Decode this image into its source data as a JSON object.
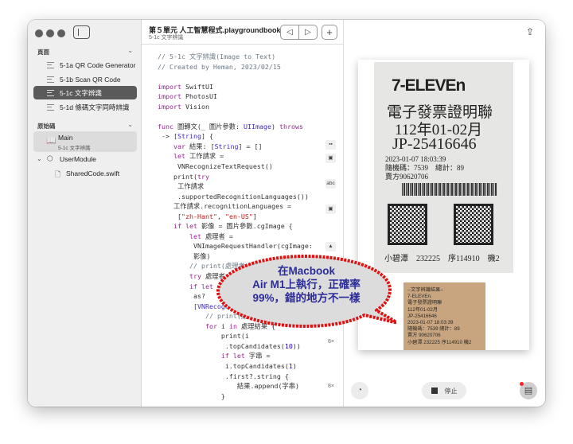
{
  "window": {
    "title": "第５單元 人工智慧程式.playgroundbook",
    "subtitle": "5-1c 文字辨識"
  },
  "sidebar": {
    "pages_header": "頁面",
    "pages": [
      {
        "label": "5-1a QR Code Generator"
      },
      {
        "label": "5-1b Scan QR Code"
      },
      {
        "label": "5-1c 文字辨識",
        "selected": true
      },
      {
        "label": "5-1d 條碼文字同時辨識"
      }
    ],
    "source_header": "原始碼",
    "main": {
      "label": "Main",
      "sub": "5-1c 文字辨識"
    },
    "module": "UserModule",
    "file": "SharedCode.swift"
  },
  "code_lines": [
    [
      [
        "// 5-1c 文字辨識(Image to Text)",
        "cm"
      ]
    ],
    [
      [
        "// Created by Heman, 2023/02/15",
        "cm"
      ]
    ],
    [],
    [
      [
        "import",
        "kw"
      ],
      [
        " SwiftUI",
        ""
      ]
    ],
    [
      [
        "import",
        "kw"
      ],
      [
        " PhotosUI",
        ""
      ]
    ],
    [
      [
        "import",
        "kw"
      ],
      [
        " Vision",
        ""
      ]
    ],
    [],
    [
      [
        "func",
        "kw"
      ],
      [
        " 圖轉文(_ 圖片參數: ",
        ""
      ],
      [
        "UIImage",
        "ty"
      ],
      [
        ") ",
        ""
      ],
      [
        "throws",
        "kw"
      ]
    ],
    [
      [
        " -> [",
        ""
      ],
      [
        "String",
        "ty"
      ],
      [
        "] {",
        ""
      ]
    ],
    [
      [
        "    ",
        ""
      ],
      [
        "var",
        "kw"
      ],
      [
        " 結果: [",
        ""
      ],
      [
        "String",
        "ty"
      ],
      [
        "] = []",
        ""
      ]
    ],
    [
      [
        "    ",
        ""
      ],
      [
        "let",
        "kw"
      ],
      [
        " 工作請求 =",
        ""
      ]
    ],
    [
      [
        "     VNRecognizeTextRequest()",
        ""
      ]
    ],
    [
      [
        "    print(",
        ""
      ],
      [
        "try",
        "kw"
      ]
    ],
    [
      [
        "     工作請求",
        ""
      ]
    ],
    [
      [
        "     .supportedRecognitionLanguages())",
        ""
      ]
    ],
    [
      [
        "    工作請求.recognitionLanguages =",
        ""
      ]
    ],
    [
      [
        "     [",
        ""
      ],
      [
        "\"zh-Hant\"",
        "st"
      ],
      [
        ", ",
        ""
      ],
      [
        "\"en-US\"",
        "st"
      ],
      [
        "]",
        ""
      ]
    ],
    [
      [
        "    ",
        ""
      ],
      [
        "if let",
        "kw"
      ],
      [
        " 影像 = 圖片參數.cgImage {",
        ""
      ]
    ],
    [
      [
        "        ",
        ""
      ],
      [
        "let",
        "kw"
      ],
      [
        " 處理者 =",
        ""
      ]
    ],
    [
      [
        "         VNImageRequestHandler(cgImage:",
        ""
      ]
    ],
    [
      [
        "         影像)",
        ""
      ]
    ],
    [
      [
        "        ",
        ""
      ],
      [
        "// print(處理者)",
        "cm"
      ]
    ],
    [
      [
        "        ",
        ""
      ],
      [
        "try",
        "kw"
      ],
      [
        " 處理者",
        ""
      ]
    ],
    [
      [
        "        ",
        ""
      ],
      [
        "if let",
        "kw"
      ]
    ],
    [
      [
        "         as?",
        ""
      ]
    ],
    [
      [
        "         [",
        ""
      ],
      [
        "VNRecognizedTextObservation",
        "ty"
      ]
    ],
    [
      [
        "            ",
        ""
      ],
      [
        "// print(處理結果)",
        "cm"
      ]
    ],
    [
      [
        "            ",
        ""
      ],
      [
        "for",
        "kw"
      ],
      [
        " i ",
        ""
      ],
      [
        "in",
        "kw"
      ],
      [
        " 處理結果 {",
        ""
      ]
    ],
    [
      [
        "                print(i",
        ""
      ]
    ],
    [
      [
        "                 .topCandidates(",
        ""
      ],
      [
        "10",
        "nu"
      ],
      [
        "))",
        ""
      ]
    ],
    [
      [
        "                ",
        ""
      ],
      [
        "if let",
        "kw"
      ],
      [
        " 字串 =",
        ""
      ]
    ],
    [
      [
        "                 i.topCandidates(",
        ""
      ],
      [
        "1",
        "nu"
      ],
      [
        ")",
        ""
      ]
    ],
    [
      [
        "                 .first?.string {",
        ""
      ]
    ],
    [
      [
        "                    結果.append(字串)",
        ""
      ]
    ],
    [
      [
        "                }",
        ""
      ]
    ]
  ],
  "gutter": {
    "abc": "abc",
    "count1": "8×",
    "count2": "8×"
  },
  "receipt": {
    "brand": "7-ELEVEn",
    "title": "電子發票證明聯",
    "period": "112年01-02月",
    "number": "JP-25416646",
    "datetime": "2023-01-07 18:03:39",
    "random": "隨機碼：7539　總計：89",
    "seller": "賣方90620706",
    "footer": "小碧潭　232225　序114910　機2"
  },
  "result_lines": [
    "--文字辨識結果--",
    "7-ELEVEn.",
    "電子發票證明聯",
    "112年01-02月",
    "JP-25416646",
    "2023-01-07 18:03:39",
    "隨機碼：7539 總計：89",
    "賣方 90620706",
    "小碧潭 232225 序114910 機2"
  ],
  "bubble": {
    "line1": "在Macbook",
    "line2": "Air M1上執行，正確率",
    "line3": "99%，錯的地方不一樣"
  },
  "controls": {
    "stop_label": "停止"
  }
}
